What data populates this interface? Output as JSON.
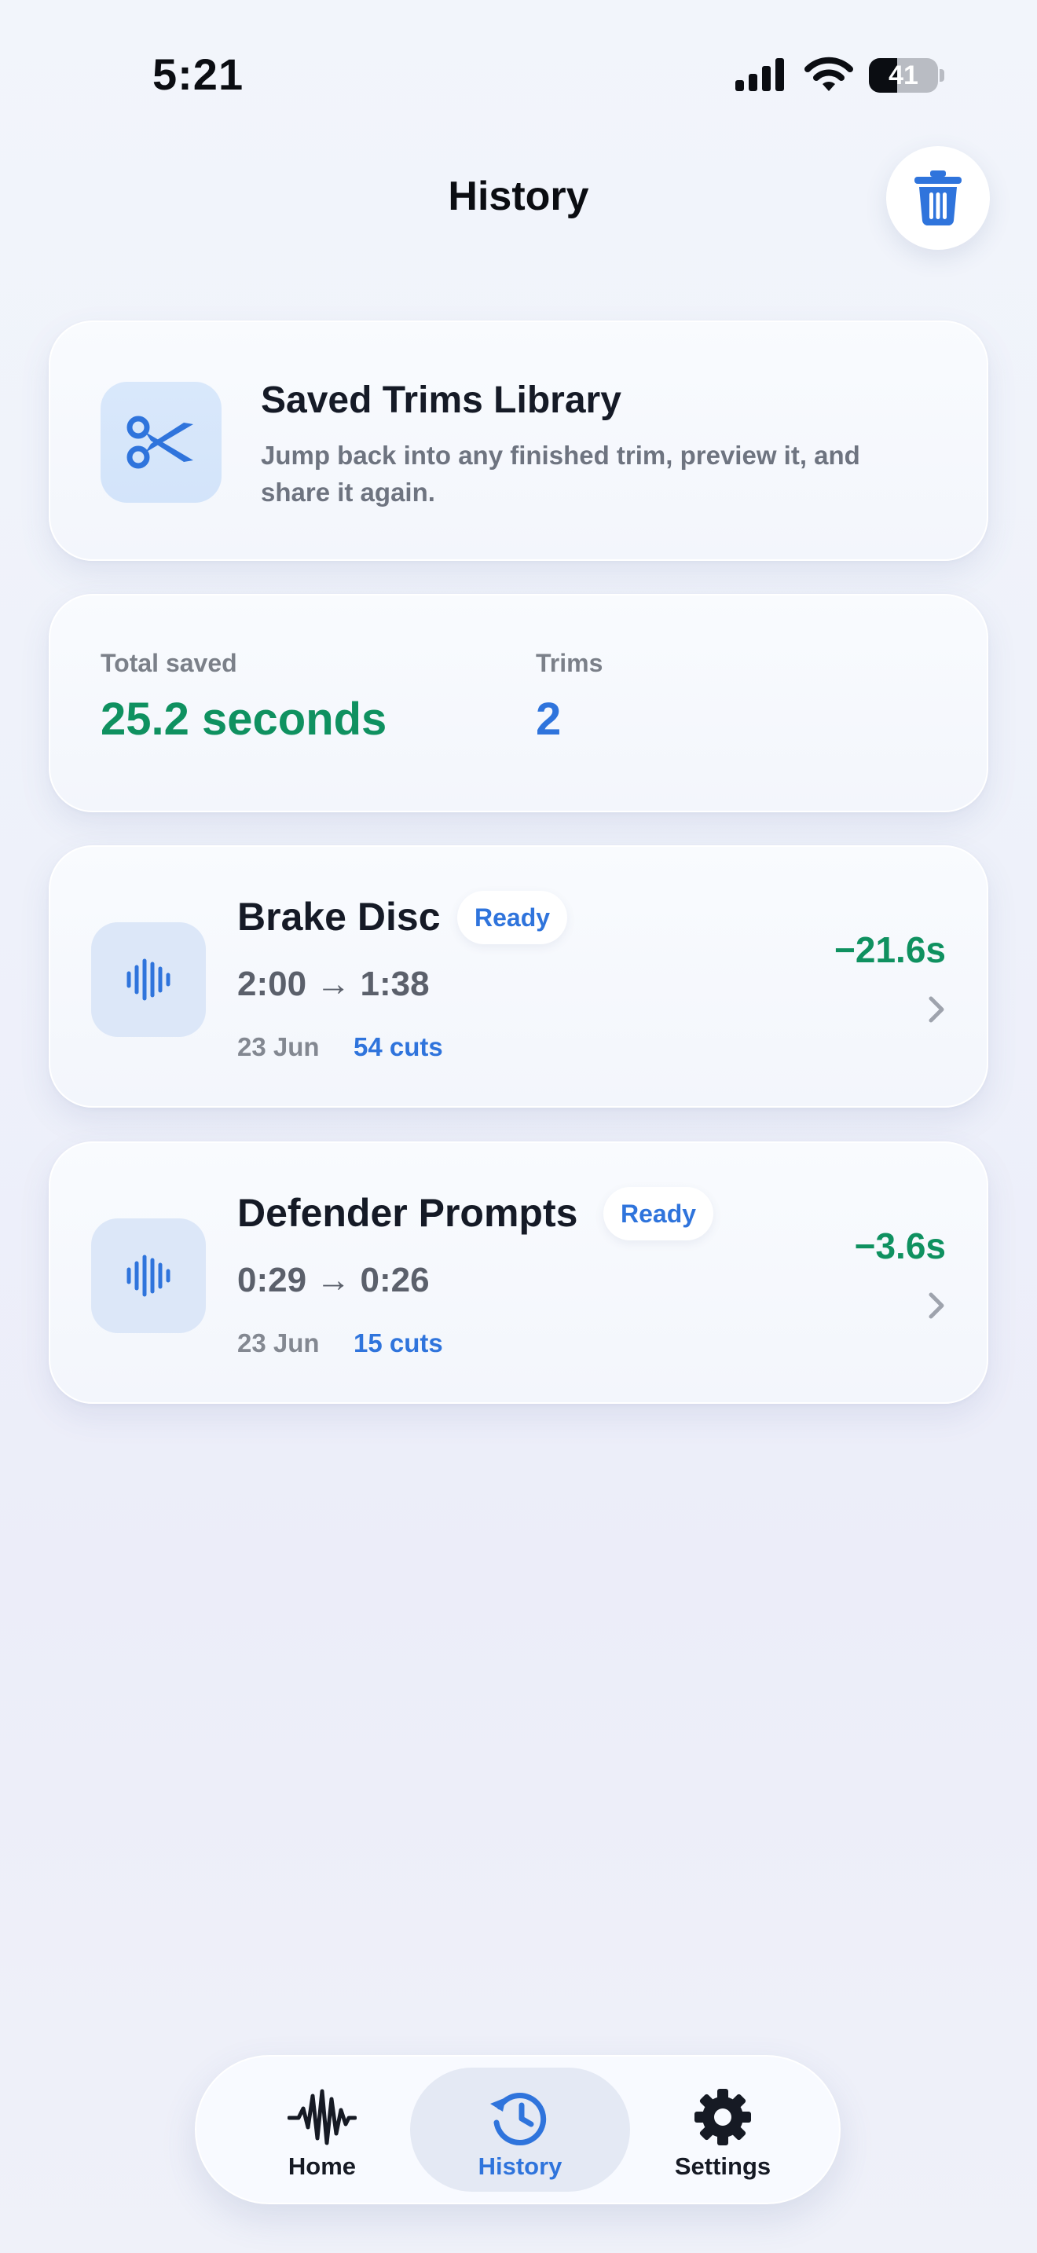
{
  "status_bar": {
    "time": "5:21",
    "battery": "41",
    "battery_level": 0.41
  },
  "header": {
    "title": "History",
    "trash_icon": "trash-icon"
  },
  "intro": {
    "icon": "scissors-icon",
    "title": "Saved Trims Library",
    "description": "Jump back into any finished trim, preview it, and share it again."
  },
  "stats": {
    "total_saved_label": "Total saved",
    "total_saved_value": "25.2 seconds",
    "trims_label": "Trims",
    "trims_value": "2"
  },
  "trims": [
    {
      "icon": "waveform-icon",
      "name": "Brake Disc",
      "status": "Ready",
      "duration": "2:00 → 1:38",
      "date": "23 Jun",
      "cuts": "54 cuts",
      "saved": "−21.6s"
    },
    {
      "icon": "waveform-icon",
      "name": "Defender Prompts",
      "status": "Ready",
      "duration": "0:29 → 0:26",
      "date": "23 Jun",
      "cuts": "15 cuts",
      "saved": "−3.6s"
    }
  ],
  "tab_bar": {
    "items": [
      {
        "label": "Home",
        "icon": "waveform-icon"
      },
      {
        "label": "History",
        "icon": "history-clock-icon",
        "active": true
      },
      {
        "label": "Settings",
        "icon": "gear-icon"
      }
    ]
  },
  "colors": {
    "accent_blue": "#2f74dc",
    "saved_green": "#0f9160",
    "muted_text": "#7b8089"
  }
}
